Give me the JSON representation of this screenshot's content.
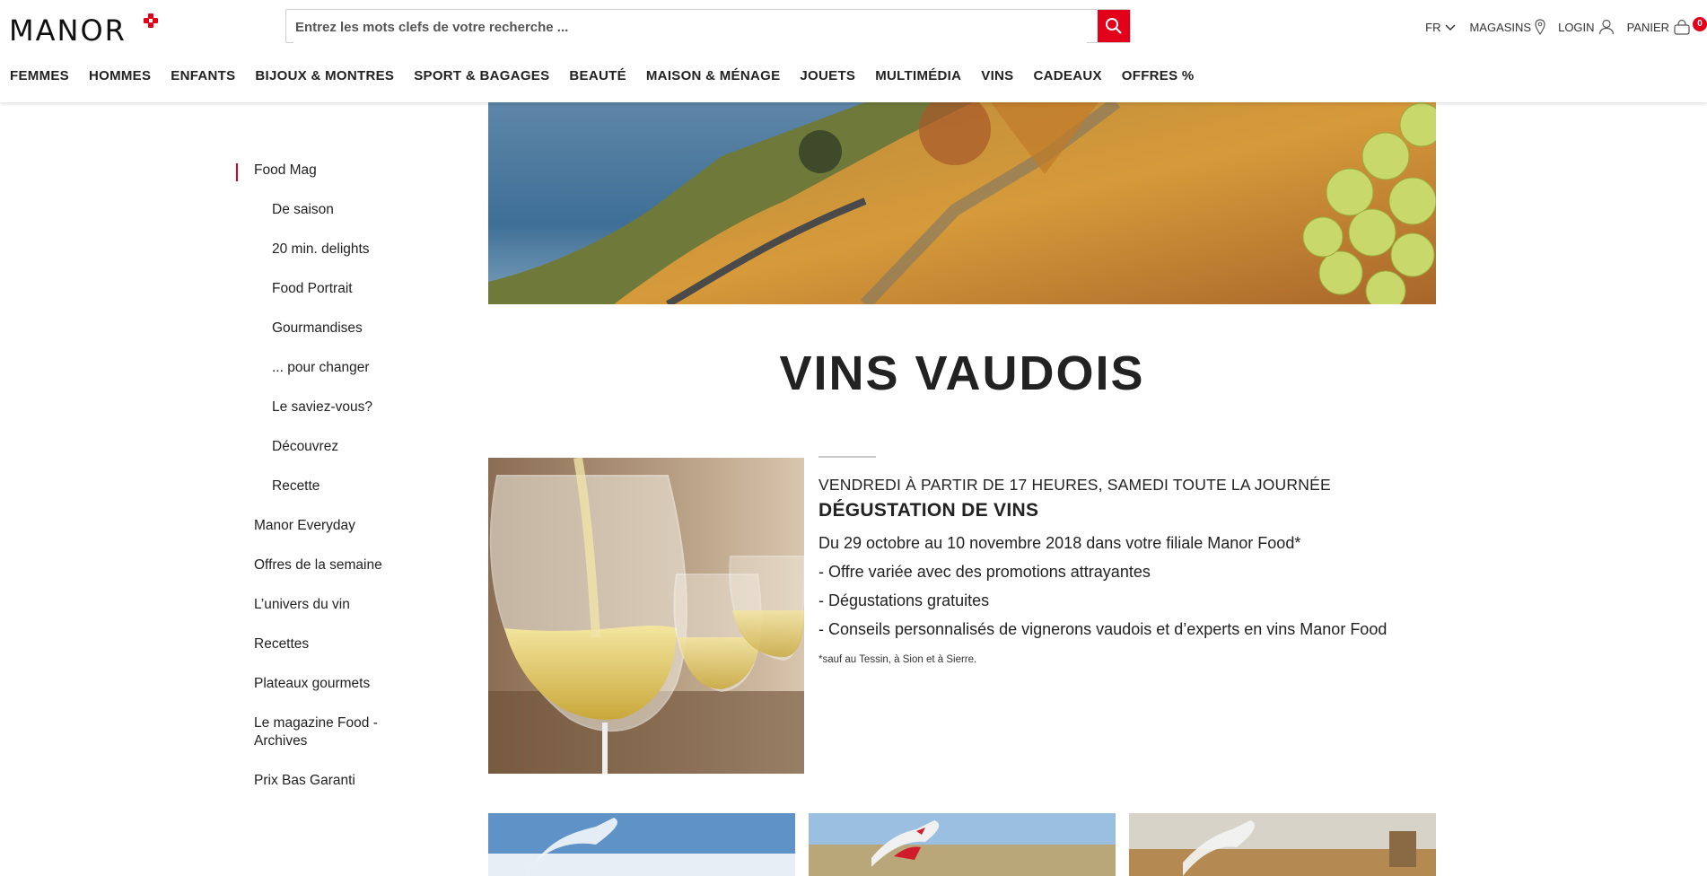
{
  "brand": {
    "name": "MANOR",
    "accent": "#e3001b"
  },
  "search": {
    "placeholder": "Entrez les mots clefs de votre recherche ..."
  },
  "utils": {
    "language": "FR",
    "stores": "MAGASINS",
    "login": "LOGIN",
    "cart": "PANIER",
    "cart_count": "0"
  },
  "nav": [
    "FEMMES",
    "HOMMES",
    "ENFANTS",
    "BIJOUX & MONTRES",
    "SPORT & BAGAGES",
    "BEAUTÉ",
    "MAISON & MÉNAGE",
    "JOUETS",
    "MULTIMÉDIA",
    "VINS",
    "CADEAUX",
    "OFFRES %"
  ],
  "sidebar": {
    "items": [
      {
        "label": "Food Mag",
        "level": "top",
        "active": true
      },
      {
        "label": "De saison",
        "level": "sub"
      },
      {
        "label": "20 min. delights",
        "level": "sub"
      },
      {
        "label": "Food Portrait",
        "level": "sub"
      },
      {
        "label": "Gourmandises",
        "level": "sub"
      },
      {
        "label": "... pour changer",
        "level": "sub"
      },
      {
        "label": "Le saviez-vous?",
        "level": "sub"
      },
      {
        "label": "Découvrez",
        "level": "sub"
      },
      {
        "label": "Recette",
        "level": "sub"
      },
      {
        "label": "Manor Everyday",
        "level": "top"
      },
      {
        "label": "Offres de la semaine",
        "level": "top"
      },
      {
        "label": "L’univers du vin",
        "level": "top"
      },
      {
        "label": "Recettes",
        "level": "top"
      },
      {
        "label": "Plateaux gourmets",
        "level": "top"
      },
      {
        "label": "Le magazine Food - Archives",
        "level": "top"
      },
      {
        "label": "Prix Bas Garanti",
        "level": "top"
      }
    ]
  },
  "page": {
    "title": "VINS VAUDOIS"
  },
  "article": {
    "kicker": "VENDREDI À PARTIR DE 17 HEURES, SAMEDI TOUTE LA JOURNÉE",
    "headline": "DÉGUSTATION DE VINS",
    "lines": [
      "Du 29 octobre au 10 novembre 2018 dans votre filiale Manor Food*",
      "- Offre variée avec des promotions attrayantes",
      "- Dégustations gratuites",
      "- Conseils personnalisés de vignerons vaudois et d’experts en vins Manor Food"
    ],
    "footnote": "*sauf au Tessin, à Sion et à Sierre."
  },
  "icons": {
    "search": "search-icon",
    "dropdown": "chevron-down-icon",
    "store": "location-pin-icon",
    "user": "user-icon",
    "cart": "basket-icon"
  }
}
